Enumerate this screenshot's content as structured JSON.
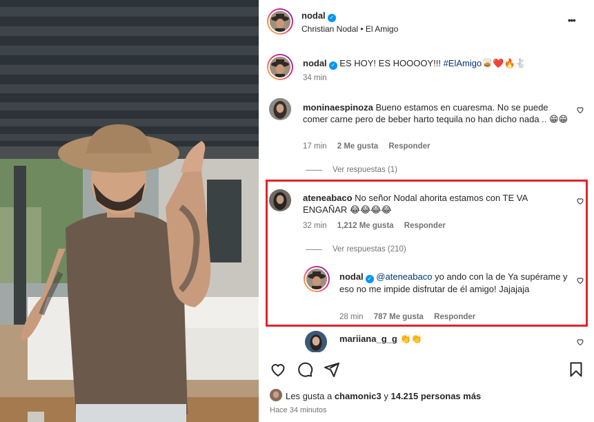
{
  "header": {
    "username": "nodal",
    "subtitle": "Christian Nodal • El Amigo",
    "more": "•••"
  },
  "caption": {
    "username": "nodal",
    "text": "ES HOY! ES HOOOOY!!! ",
    "hashtag": "#ElAmigo",
    "emojis": "🥃❤️🔥🐇",
    "time": "34 min"
  },
  "comments": [
    {
      "username": "moninaespinoza",
      "text": "Bueno estamos en cuaresma. No se puede comer carne pero de beber harto tequila no han dicho nada ..",
      "emojis": "😁😁",
      "time": "17 min",
      "likes": "2 Me gusta",
      "reply": "Responder",
      "view_replies": "Ver respuestas (1)"
    },
    {
      "username": "ateneabaco",
      "text": "No señor Nodal ahorita estamos con TE VA ENGAÑAR 😂😂😂😂",
      "time": "32 min",
      "likes": "1,212 Me gusta",
      "reply": "Responder",
      "view_replies": "Ver respuestas (210)"
    }
  ],
  "reply": {
    "username": "nodal",
    "mention": "@ateneabaco",
    "text": " yo ando con la de Ya supérame y eso no me impide disfrutar de él amigo! Jajajaja",
    "time": "28 min",
    "likes": "787 Me gusta",
    "reply": "Responder"
  },
  "partial_comment": {
    "username": "mariiana_g_g",
    "emojis": "👏👏"
  },
  "likes_line": {
    "prefix": "Les gusta a ",
    "user": "chamonic3",
    "middle": " y ",
    "count": "14.215 personas más"
  },
  "timestamp": "Hace 34 minutos",
  "colors": {
    "highlight": "#e0232b",
    "link": "#00376b",
    "verified": "#0095f6"
  },
  "icons": [
    "heart-icon",
    "comment-icon",
    "share-icon",
    "bookmark-icon",
    "more-icon",
    "verified-icon"
  ]
}
